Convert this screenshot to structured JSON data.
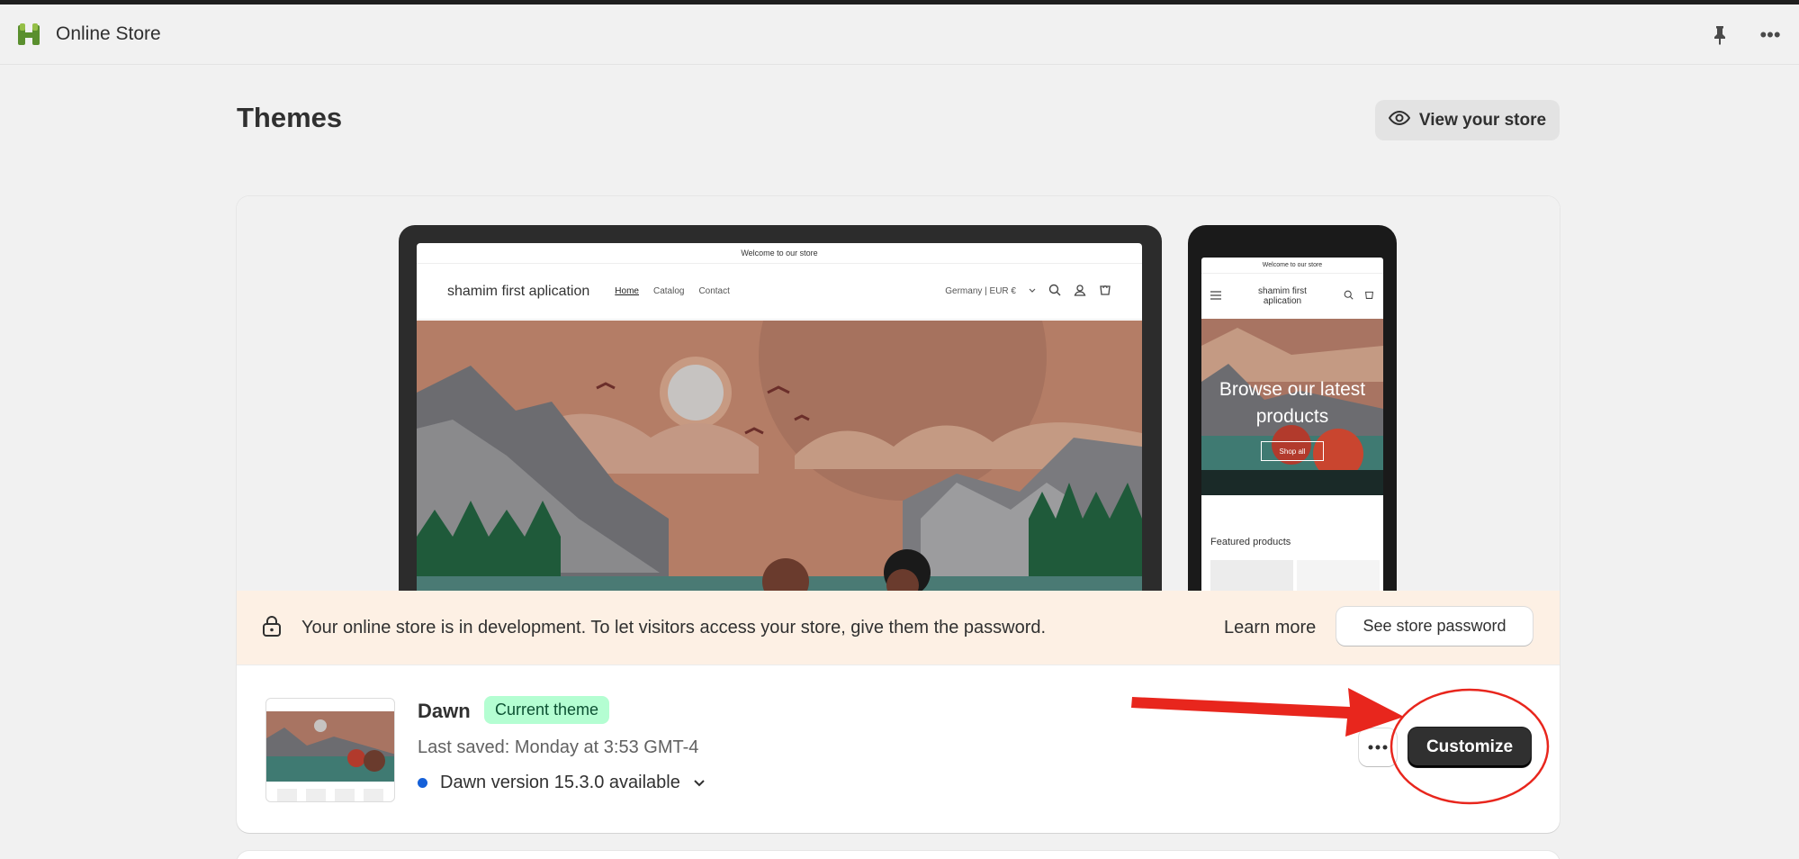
{
  "app": {
    "title": "Online Store",
    "logo_icon": "shopify-app-icon"
  },
  "appbar": {
    "pin_icon": "pin-icon",
    "more_icon": "more-horizontal-icon",
    "more_glyph": "•••"
  },
  "page": {
    "title": "Themes",
    "view_store_label": "View your store",
    "view_store_icon": "eye-icon"
  },
  "preview": {
    "desktop": {
      "announcement": "Welcome to our store",
      "brand": "shamim first aplication",
      "nav": [
        "Home",
        "Catalog",
        "Contact"
      ],
      "locale": "Germany | EUR €"
    },
    "mobile": {
      "announcement": "Welcome to our store",
      "brand_line1": "shamim first",
      "brand_line2": "aplication",
      "hero_line1": "Browse our latest",
      "hero_line2": "products",
      "shop_all": "Shop all",
      "featured": "Featured products"
    }
  },
  "banner": {
    "message": "Your online store is in development. To let visitors access your store, give them the password.",
    "learn_more": "Learn more",
    "see_password": "See store password",
    "icon": "lock-icon"
  },
  "theme": {
    "name": "Dawn",
    "badge": "Current theme",
    "last_saved": "Last saved: Monday at 3:53 GMT-4",
    "version": "Dawn version 15.3.0 available",
    "customize_label": "Customize",
    "status_color": "#1560d8"
  },
  "colors": {
    "annotation_red": "#e8261d",
    "badge_bg": "#b4fed2",
    "banner_bg": "#fdf0e4",
    "primary_button": "#303030"
  }
}
